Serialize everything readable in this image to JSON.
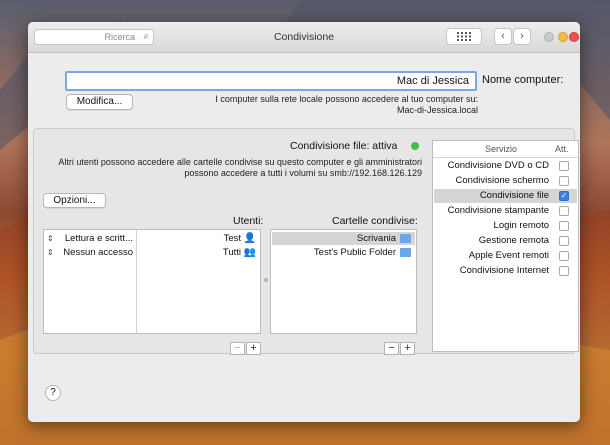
{
  "window": {
    "title": "Condivisione",
    "search_placeholder": "Ricerca",
    "grid_icon": "grid-icon",
    "nav_back": "‹",
    "nav_forward": "›"
  },
  "computer_name": {
    "label": "Nome computer:",
    "value": "Mac di Jessica",
    "description_line1": "I computer sulla rete locale possono accedere al tuo computer su:",
    "description_line2": "Mac-di-Jessica.local",
    "edit_button": "Modifica..."
  },
  "services": {
    "header_on": "Att.",
    "header_service": "Servizio",
    "items": [
      {
        "label": "Condivisione DVD o CD",
        "checked": false,
        "selected": false
      },
      {
        "label": "Condivisione schermo",
        "checked": false,
        "selected": false
      },
      {
        "label": "Condivisione file",
        "checked": true,
        "selected": true
      },
      {
        "label": "Condivisione stampante",
        "checked": false,
        "selected": false
      },
      {
        "label": "Login remoto",
        "checked": false,
        "selected": false
      },
      {
        "label": "Gestione remota",
        "checked": false,
        "selected": false
      },
      {
        "label": "Apple Event remoti",
        "checked": false,
        "selected": false
      },
      {
        "label": "Condivisione Internet",
        "checked": false,
        "selected": false
      }
    ]
  },
  "file_sharing": {
    "status": "Condivisione file: attiva",
    "status_color": "#3fbe3f",
    "description_line1": "Altri utenti possono accedere alle cartelle condivise su questo computer e gli amministratori",
    "description_line2": "possono accedere a tutti i volumi su smb://192.168.126.129",
    "options_button": "Opzioni...",
    "shared_folders_label": "Cartelle condivise:",
    "users_label": "Utenti:",
    "shared_folders": [
      {
        "name": "Scrivania",
        "selected": true
      },
      {
        "name": "Test's Public Folder",
        "selected": false
      }
    ],
    "users": [
      {
        "name": "Test",
        "permission": "Lettura e scritt..."
      },
      {
        "name": "Tutti",
        "permission": "Nessun accesso"
      }
    ],
    "add_label": "+",
    "remove_label": "−"
  },
  "help": "?",
  "accent": "#3b82e6"
}
